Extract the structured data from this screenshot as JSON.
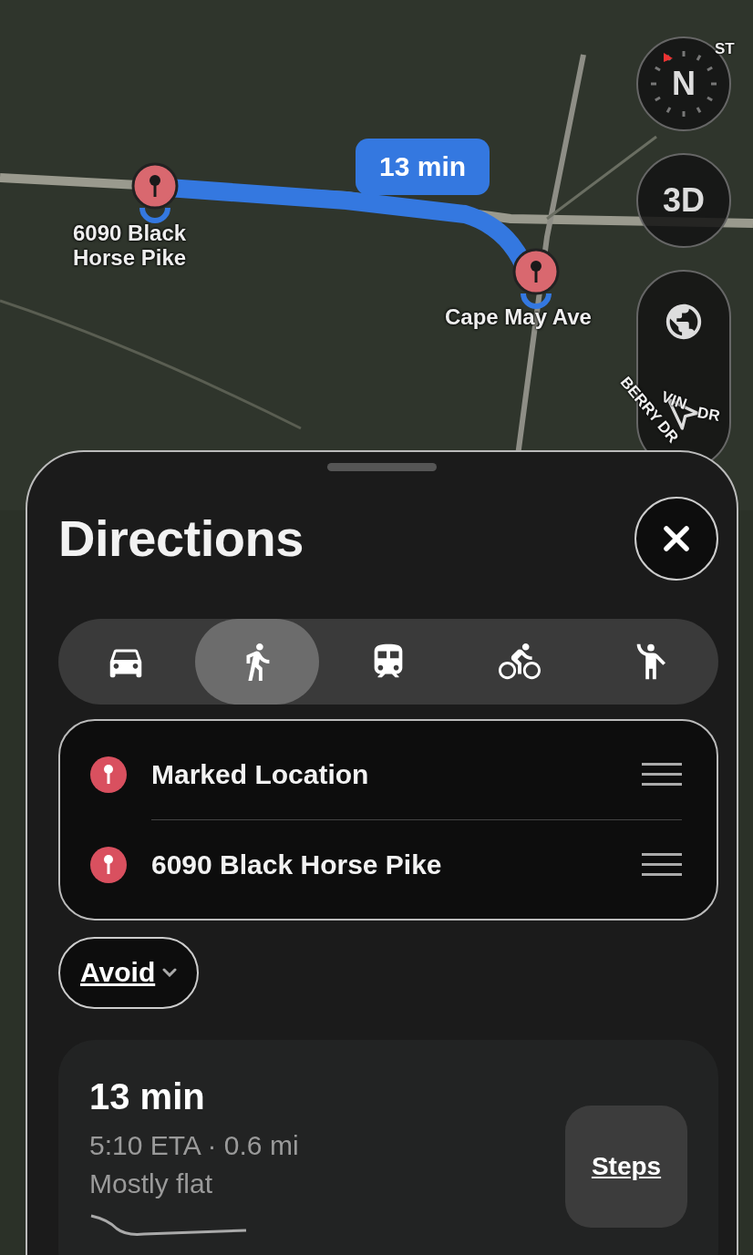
{
  "map": {
    "route_label": "13 min",
    "places": [
      {
        "kind": "start",
        "lines": [
          "6090 Black",
          "Horse Pike"
        ]
      },
      {
        "kind": "end",
        "lines": [
          "Cape May Ave"
        ]
      }
    ],
    "street_labels": [
      {
        "kind": "apple",
        "text": "ST"
      },
      {
        "kind": "berry",
        "text": "BERRY DR"
      },
      {
        "kind": "vine",
        "text": "VIN"
      },
      {
        "kind": "vine2",
        "text": "DR"
      }
    ],
    "compass": "N",
    "view_toggle": "3D"
  },
  "sheet": {
    "title": "Directions",
    "modes": [
      {
        "kind": "car",
        "selected": false
      },
      {
        "kind": "walk",
        "selected": true
      },
      {
        "kind": "transit",
        "selected": false
      },
      {
        "kind": "bike",
        "selected": false
      },
      {
        "kind": "ride",
        "selected": false
      }
    ],
    "waypoints": [
      {
        "name": "Marked Location"
      },
      {
        "name": "6090 Black Horse Pike"
      }
    ],
    "avoid": "Avoid",
    "route": {
      "time": "13 min",
      "eta": "5:10 ETA · 0.6 mi",
      "terrain": "Mostly flat",
      "steps": "Steps"
    }
  }
}
